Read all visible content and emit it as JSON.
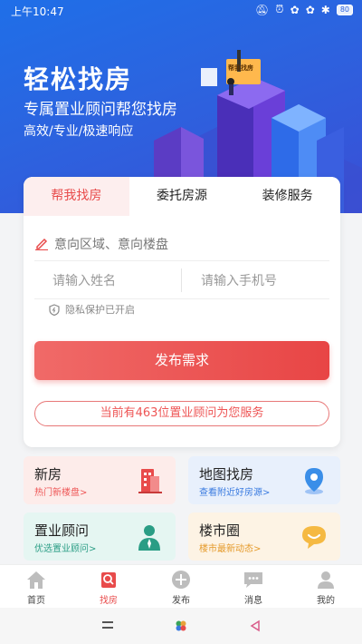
{
  "status_bar": {
    "time": "上午10:47",
    "battery": "80"
  },
  "hero": {
    "title": "轻松找房",
    "subtitle": "专属置业顾问帮您找房",
    "tags": "高效/专业/极速响应",
    "billboard_text": "帮我找房"
  },
  "tabs": [
    {
      "label": "帮我找房",
      "active": true
    },
    {
      "label": "委托房源",
      "active": false
    },
    {
      "label": "装修服务",
      "active": false
    }
  ],
  "form": {
    "area_placeholder": "意向区域、意向楼盘",
    "name_placeholder": "请输入姓名",
    "phone_placeholder": "请输入手机号",
    "privacy_text": "隐私保护已开启",
    "submit_label": "发布需求",
    "advisor_text": "当前有463位置业顾问为您服务"
  },
  "tiles": [
    {
      "title": "新房",
      "subtitle": "热门新楼盘>",
      "icon": "building-icon",
      "color": "#e84b4b"
    },
    {
      "title": "地图找房",
      "subtitle": "查看附近好房源>",
      "icon": "map-pin-icon",
      "color": "#3a7be0"
    },
    {
      "title": "置业顾问",
      "subtitle": "优选置业顾问>",
      "icon": "advisor-icon",
      "color": "#2a9d85"
    },
    {
      "title": "楼市圈",
      "subtitle": "楼市最新动态>",
      "icon": "chat-bubble-icon",
      "color": "#f0b429"
    }
  ],
  "bottom_nav": [
    {
      "label": "首页",
      "icon": "home-icon",
      "active": false
    },
    {
      "label": "找房",
      "icon": "find-house-icon",
      "active": true
    },
    {
      "label": "发布",
      "icon": "plus-circle-icon",
      "active": false
    },
    {
      "label": "消息",
      "icon": "message-icon",
      "active": false
    },
    {
      "label": "我的",
      "icon": "profile-icon",
      "active": false
    }
  ],
  "colors": {
    "primary_blue": "#2c63df",
    "accent_red": "#e84b4b"
  }
}
